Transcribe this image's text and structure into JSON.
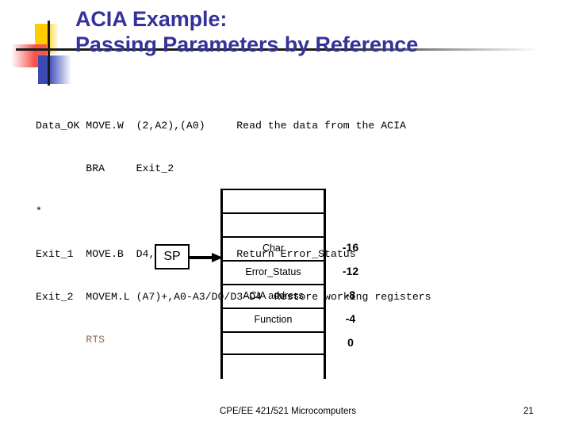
{
  "slide": {
    "title": "ACIA Example:\nPassing Parameters by Reference",
    "title_color": "#333399"
  },
  "code": {
    "lines": [
      {
        "text": "Data_OK MOVE.W  (2,A2),(A0)     Read the data from the ACIA",
        "color": "#000000"
      },
      {
        "text": "        BRA     Exit_2",
        "color": "#000000"
      },
      {
        "text": "*",
        "color": "#000000"
      },
      {
        "text": "Exit_1  MOVE.B  D4,(A1)         Return Error_Status",
        "color": "#000000"
      },
      {
        "text": "Exit_2  MOVEM.L (A7)+,A0-A3/D0/D3-D4  Restore working registers",
        "color": "#000000"
      },
      {
        "text": "        RTS",
        "color": "#8a6b55"
      }
    ]
  },
  "stack": {
    "pointer_label": "SP",
    "rows": [
      {
        "label": "",
        "offset": ""
      },
      {
        "label": "",
        "offset": ""
      },
      {
        "label": "Char",
        "offset": "-16"
      },
      {
        "label": "Error_Status",
        "offset": "-12"
      },
      {
        "label": "ACIA address",
        "offset": "-8"
      },
      {
        "label": "Function",
        "offset": "-4"
      },
      {
        "label": "",
        "offset": "0"
      }
    ]
  },
  "footer": {
    "course": "CPE/EE 421/521 Microcomputers",
    "page_number": "21"
  }
}
